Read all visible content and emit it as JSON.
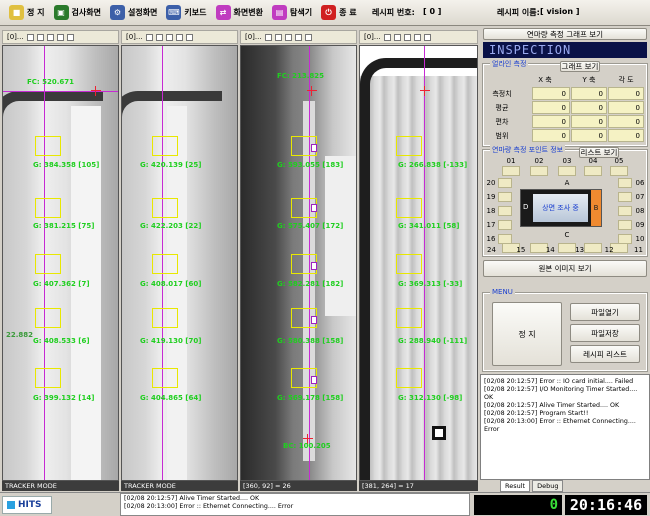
{
  "toolbar": {
    "buttons": [
      {
        "label": "정 지",
        "icon": "stop-icon",
        "color": "#e0c040"
      },
      {
        "label": "검사화면",
        "icon": "inspect-screen-icon",
        "color": "#2b7a2b"
      },
      {
        "label": "설정화면",
        "icon": "settings-screen-icon",
        "color": "#3c5fa8"
      },
      {
        "label": "키보드",
        "icon": "keyboard-icon",
        "color": "#3c5fa8"
      },
      {
        "label": "화면변환",
        "icon": "switch-screen-icon",
        "color": "#c03cc0"
      },
      {
        "label": "탐색기",
        "icon": "explorer-icon",
        "color": "#c03cc0"
      },
      {
        "label": "종 료",
        "icon": "exit-icon",
        "color": "#d02020"
      }
    ],
    "recipe_no_label": "레시피 번호:",
    "recipe_no_value": "[ 0 ]",
    "recipe_name_label": "레시피 이름:",
    "recipe_name_value": "[ vision ]"
  },
  "panes": [
    {
      "head": "[0]...",
      "status": "TRACKER MODE",
      "top_label": "FC: 520.671",
      "labels": [
        "G: 384.358 [105]",
        "G: 381.215 [75]",
        "G: 407.362 [7]",
        "G: 408.533 [6]",
        "G: 399.132 [14]"
      ],
      "side_label": "22.882"
    },
    {
      "head": "[0]...",
      "status": "TRACKER MODE",
      "labels": [
        "G: 420.139 [25]",
        "G: 422.203 [22]",
        "G: 408.017 [60]",
        "G: 419.130 [70]",
        "G: 404.865 [64]"
      ]
    },
    {
      "head": "[0]...",
      "status": "[360, 92] = 26",
      "top_label": "FC: 213.825",
      "labels": [
        "G: 593.055 [183]",
        "G: 575.407 [172]",
        "G: 582.281 [182]",
        "G: 580.388 [158]",
        "G: 569.178 [158]"
      ],
      "bottom_label": "BC: 100.205"
    },
    {
      "head": "[0]...",
      "status": "[381, 264] = 17",
      "labels": [
        "G: 266.838 [-133]",
        "G: 341.011 [58]",
        "G: 369.313 [-33]",
        "G: 288.940 [-111]",
        "G: 312.130 [-98]"
      ]
    }
  ],
  "right": {
    "top_button": "연마량 측정 그래프 보기",
    "inspection": "INSPECTION",
    "g1_title": "얼라인 측정",
    "graph_btn": "그래프 보기",
    "cols": [
      "X 축",
      "Y 축",
      "각 도"
    ],
    "rows": [
      {
        "label": "측정치",
        "values": [
          "0",
          "0",
          "0"
        ]
      },
      {
        "label": "평균",
        "values": [
          "0",
          "0",
          "0"
        ]
      },
      {
        "label": "편차",
        "values": [
          "0",
          "0",
          "0"
        ]
      },
      {
        "label": "범위",
        "values": [
          "0",
          "0",
          "0"
        ]
      }
    ],
    "g2_title": "연마량 측정 포인트 정보",
    "list_btn": "리스트 보기",
    "top_nums": [
      "01",
      "02",
      "03",
      "04",
      "05"
    ],
    "left_nums": [
      "20",
      "19",
      "18",
      "17",
      "16"
    ],
    "right_nums": [
      "06",
      "07",
      "08",
      "09",
      "10"
    ],
    "bottom_nums": [
      "24",
      "15",
      "14",
      "13",
      "12",
      "11"
    ],
    "label_a": "A",
    "label_b": "B",
    "label_c": "C",
    "label_d": "D",
    "center_label": "상면 조사 중",
    "orig_btn": "원본 이미지 보기",
    "menu_title": "MENU",
    "stop_btn": "정 지",
    "open_btn": "파일열기",
    "save_btn": "파일저장",
    "recipe_list_btn": "레시피 리스트"
  },
  "log": [
    "[02/08 20:12:57]  Error :: IO card initial.... Failed",
    "[02/08 20:12:57]  I/O Monitoring Timer Started.... OK",
    "[02/08 20:12:57]  Alive Timer Started.... OK",
    "[02/08 20:12:57]  Program Start!!",
    "[02/08 20:13:00]  Error :: Ethernet Connecting.... Error"
  ],
  "tabs": [
    "Result",
    "Debug"
  ],
  "bottom_log": [
    "[02/08 20:12:57]  Alive Timer Started.... OK",
    "[02/08 20:13:00]  Error :: Ethernet Connecting.... Error"
  ],
  "logo": "HITS",
  "led_counter": "0",
  "clock": "20:16:46"
}
